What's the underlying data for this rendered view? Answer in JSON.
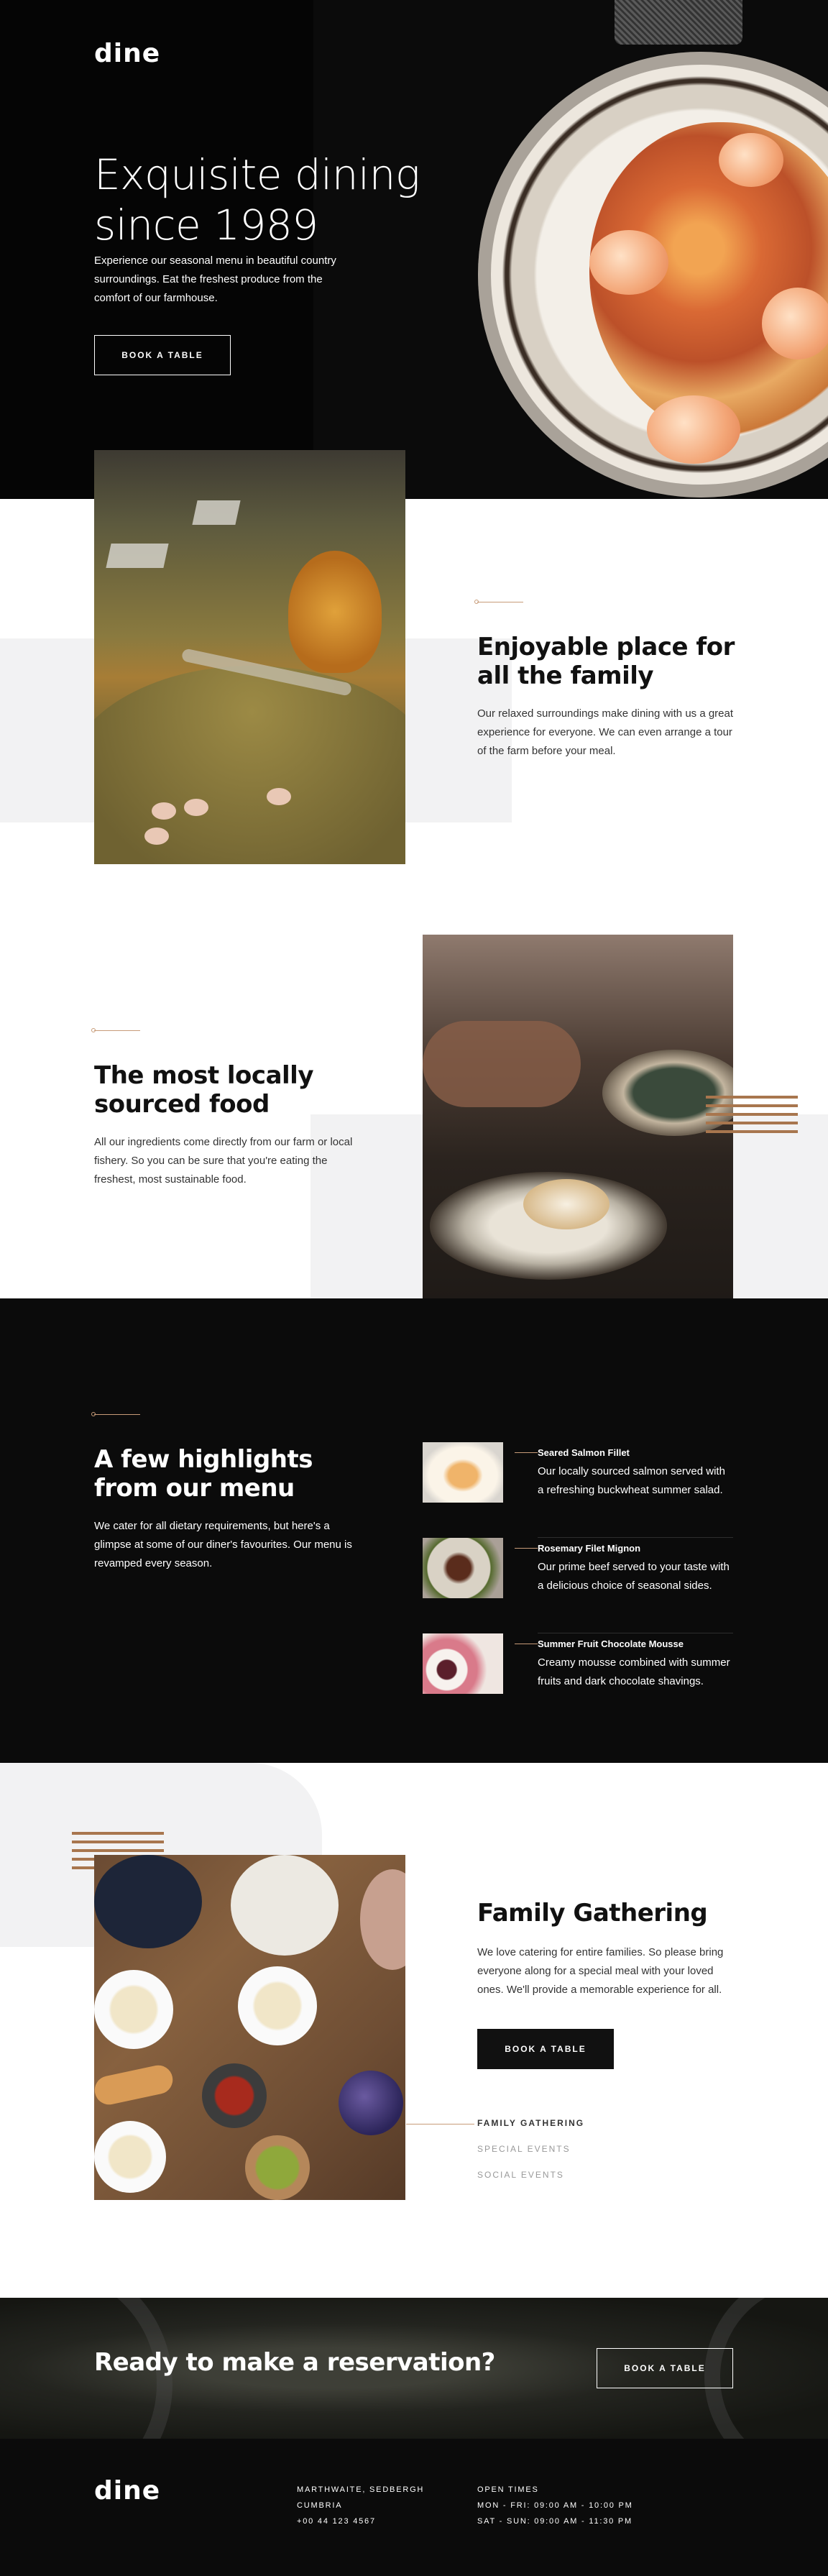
{
  "brand": {
    "logo": "dine"
  },
  "hero": {
    "title": "Exquisite dining since 1989",
    "text": "Experience our seasonal menu in beautiful country surroundings. Eat the freshest produce from the comfort of our farmhouse.",
    "button": "BOOK A TABLE"
  },
  "family": {
    "title": "Enjoyable place for all the family",
    "text": "Our relaxed surroundings make dining with us a great experience for everyone. We can even arrange a tour of the farm before your meal."
  },
  "local": {
    "title": "The most locally sourced food",
    "text": "All our ingredients come directly from our farm or local fishery. So you can be sure that you're eating the freshest, most sustainable food."
  },
  "menu": {
    "title": "A few highlights from our menu",
    "text": "We cater for all dietary requirements, but here's a glimpse at some of our diner's favourites. Our menu is revamped every season.",
    "items": [
      {
        "name": "Seared Salmon Fillet",
        "desc": "Our locally sourced salmon served with a refreshing buckwheat summer salad."
      },
      {
        "name": "Rosemary Filet Mignon",
        "desc": "Our prime beef served to your taste with a delicious choice of seasonal sides."
      },
      {
        "name": "Summer Fruit Chocolate Mousse",
        "desc": "Creamy mousse combined with summer fruits and dark chocolate shavings."
      }
    ]
  },
  "events": {
    "title": "Family Gathering",
    "text": "We love catering for entire families. So please bring everyone along for a special meal with your loved ones. We'll provide a memorable experience for all.",
    "button": "BOOK A TABLE",
    "tabs": [
      "FAMILY GATHERING",
      "SPECIAL EVENTS",
      "SOCIAL EVENTS"
    ]
  },
  "cta": {
    "title": "Ready to make a reservation?",
    "button": "BOOK A TABLE"
  },
  "footer": {
    "address": [
      "MARTHWAITE, SEDBERGH",
      "CUMBRIA",
      "+00 44 123 4567"
    ],
    "hours": [
      "OPEN TIMES",
      "MON - FRI: 09:00 AM - 10:00 PM",
      "SAT - SUN: 09:00 AM - 11:30 PM"
    ]
  },
  "colors": {
    "accent": "#c79b78",
    "dark": "#0b0b0b",
    "grey": "#f2f2f3"
  }
}
